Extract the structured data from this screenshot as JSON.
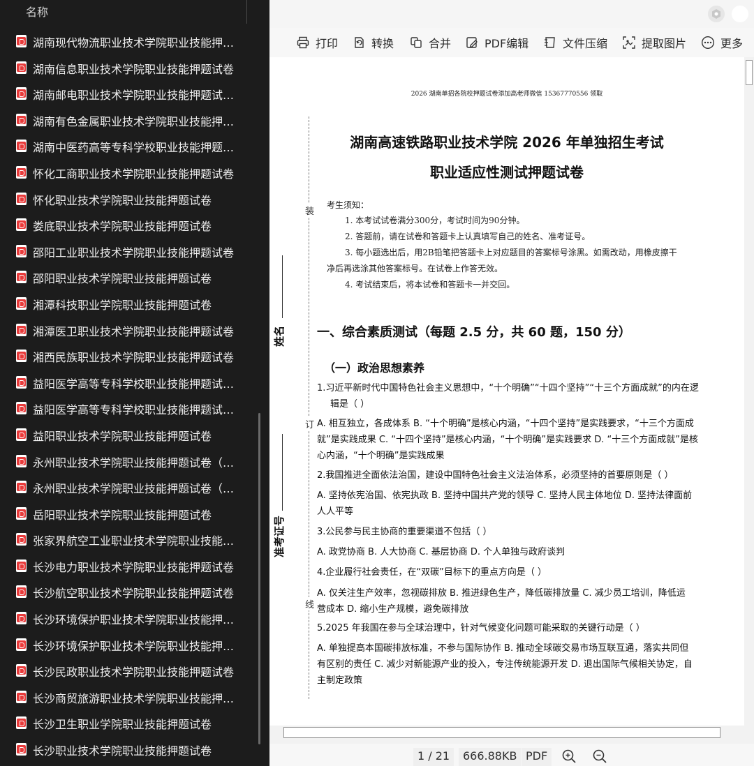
{
  "sidebar": {
    "column_title": "名称",
    "sort_mark": "^",
    "files": [
      "湖南现代物流职业技术学院职业技能押题...",
      "湖南信息职业技术学院职业技能押题试卷",
      "湖南邮电职业技术学院职业技能押题试卷...",
      "湖南有色金属职业技术学院职业技能押题...",
      "湖南中医药高等专科学校职业技能押题试...",
      "怀化工商职业技术学院职业技能押题试卷",
      "怀化职业技术学院职业技能押题试卷",
      "娄底职业技术学院职业技能押题试卷",
      "邵阳工业职业技术学院职业技能押题试卷",
      "邵阳职业技术学院职业技能押题试卷",
      "湘潭科技职业学院职业技能押题试卷",
      "湘潭医卫职业技术学院职业技能押题试卷",
      "湘西民族职业技术学院职业技能押题试卷",
      "益阳医学高等专科学校职业技能押题试卷...",
      "益阳医学高等专科学校职业技能押题试卷...",
      "益阳职业技术学院职业技能押题试卷",
      "永州职业技术学院职业技能押题试卷（普...",
      "永州职业技术学院职业技能押题试卷（中...",
      "岳阳职业技术学院职业技能押题试卷",
      "张家界航空工业职业技术学院职业技能押...",
      "长沙电力职业技术学院职业技能押题试卷",
      "长沙航空职业技术学院职业技能押题试卷",
      "长沙环境保护职业技术学院职业技能押题...",
      "长沙环境保护职业技术学院职业技能押题...",
      "长沙民政职业技术学院职业技能押题试卷",
      "长沙商贸旅游职业技术学院职业技能押题...",
      "长沙卫生职业学院职业技能押题试卷",
      "长沙职业技术学院职业技能押题试卷"
    ]
  },
  "toolbar": {
    "print": "打印",
    "convert": "转换",
    "merge": "合并",
    "pdf_edit": "PDF编辑",
    "compress": "文件压缩",
    "extract_images": "提取图片",
    "more": "更多"
  },
  "document": {
    "header_note": "2026 湖南单招各院校押题试卷添加高老师微信 15367770556 领取",
    "title_line1": "湖南高速铁路职业技术学院 2026 年单独招生考试",
    "title_line2": "职业适应性测试押题试卷",
    "gutter": {
      "zhuang": "装",
      "ding": "订",
      "xian": "线"
    },
    "side_name": "姓名",
    "side_id": "准考证号",
    "notice_title": "考生须知：",
    "notice_1": "1. 本考试试卷满分300分，考试时间为90分钟。",
    "notice_2": "2. 答题前，请在试卷和答题卡上认真填写自己的姓名、准考证号。",
    "notice_3": "3. 每小题选出后，用2B铅笔把答题卡上对应题目的答案标号涂黑。如需改动，用橡皮擦干",
    "notice_3b": "净后再选涂其他答案标号。在试卷上作答无效。",
    "notice_4": "4. 考试结束后，将本试卷和答题卡一并交回。",
    "section_1": "一、综合素质测试（每题 2.5 分，共 60 题，150 分）",
    "subsection_1": "（一）政治思想素养",
    "q1": "1.习近平新时代中国特色社会主义思想中，“十个明确”“十四个坚持”“十三个方面成就”的内在逻",
    "q1b": "辑是（ ）",
    "q1_opts": "A. 相互独立，各成体系 B. “十个明确”是核心内涵，“十四个坚持”是实践要求，“十三个方面成",
    "q1_opts_b": "就”是实践成果 C. “十四个坚持”是核心内涵，“十个明确”是实践要求 D. “十三个方面成就”是核",
    "q1_opts_c": "心内涵，“十个明确”是实践成果",
    "q2": "2.我国推进全面依法治国，建设中国特色社会主义法治体系，必须坚持的首要原则是（ ）",
    "q2_opts": "A. 坚持依宪治国、依宪执政 B. 坚持中国共产党的领导 C. 坚持人民主体地位 D. 坚持法律面前",
    "q2_opts_b": "人人平等",
    "q3": "3.公民参与民主协商的重要渠道不包括（ ）",
    "q3_opts": "A. 政党协商 B. 人大协商 C. 基层协商 D. 个人单独与政府谈判",
    "q4": "4.企业履行社会责任，在“双碳”目标下的重点方向是（ ）",
    "q4_opts": "A. 仅关注生产效率，忽视碳排放 B. 推进绿色生产，降低碳排放量 C. 减少员工培训，降低运",
    "q4_opts_b": "营成本 D. 缩小生产规模，避免碳排放",
    "q5": "5.2025 年我国在参与全球治理中，针对气候变化问题可能采取的关键行动是（ ）",
    "q5_opts": "A. 单独提高本国碳排放标准，不参与国际协作 B. 推动全球碳交易市场互联互通，落实共同但",
    "q5_opts_b": "有区别的责任 C. 减少对新能源产业的投入，专注传统能源开发 D. 退出国际气候相关协定，自",
    "q5_opts_c": "主制定政策"
  },
  "status": {
    "page": "1 / 21",
    "size": "666.88KB",
    "format": "PDF"
  }
}
